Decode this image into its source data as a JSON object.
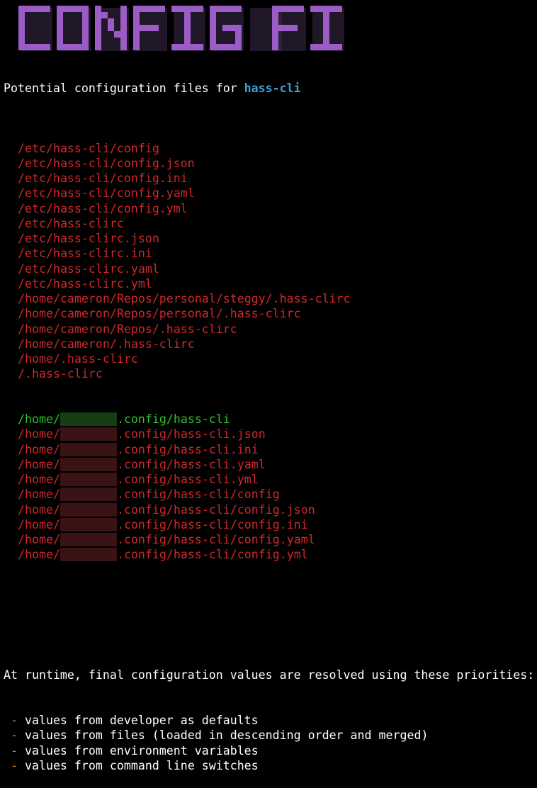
{
  "banner": {
    "title": "CONFIG FILES"
  },
  "heading": {
    "prefix": "Potential configuration files for ",
    "app": "hass-cli"
  },
  "config_paths": [
    "/etc/hass-cli/config",
    "/etc/hass-cli/config.json",
    "/etc/hass-cli/config.ini",
    "/etc/hass-cli/config.yaml",
    "/etc/hass-cli/config.yml",
    "/etc/hass-clirc",
    "/etc/hass-clirc.json",
    "/etc/hass-clirc.ini",
    "/etc/hass-clirc.yaml",
    "/etc/hass-clirc.yml",
    "/home/cameron/Repos/personal/steggy/.hass-clirc",
    "/home/cameron/Repos/personal/.hass-clirc",
    "/home/cameron/Repos/.hass-clirc",
    "/home/cameron/.hass-clirc",
    "/home/.hass-clirc",
    "/.hass-clirc"
  ],
  "home_prefix": "/home/",
  "home_paths": [
    {
      "suffix": ".config/hass-cli",
      "found": true
    },
    {
      "suffix": ".config/hass-cli.json",
      "found": false
    },
    {
      "suffix": ".config/hass-cli.ini",
      "found": false
    },
    {
      "suffix": ".config/hass-cli.yaml",
      "found": false
    },
    {
      "suffix": ".config/hass-cli.yml",
      "found": false
    },
    {
      "suffix": ".config/hass-cli/config",
      "found": false
    },
    {
      "suffix": ".config/hass-cli/config.json",
      "found": false
    },
    {
      "suffix": ".config/hass-cli/config.ini",
      "found": false
    },
    {
      "suffix": ".config/hass-cli/config.yaml",
      "found": false
    },
    {
      "suffix": ".config/hass-cli/config.yml",
      "found": false
    }
  ],
  "runtime": {
    "intro": "At runtime, final configuration values are resolved using these priorities:",
    "bullet": "-",
    "priorities": [
      "values from developer as defaults",
      "values from files (loaded in descending order and merged)",
      "values from environment variables",
      "values from command line switches"
    ]
  },
  "colors": {
    "background": "#000000",
    "missing_path": "#d02828",
    "found_path": "#2bc52b",
    "app_name": "#3aa0e0",
    "bullet": "#e8801f",
    "banner_fill": "#9b5cc6",
    "banner_shadow": "#3a2a48"
  },
  "icons": {}
}
